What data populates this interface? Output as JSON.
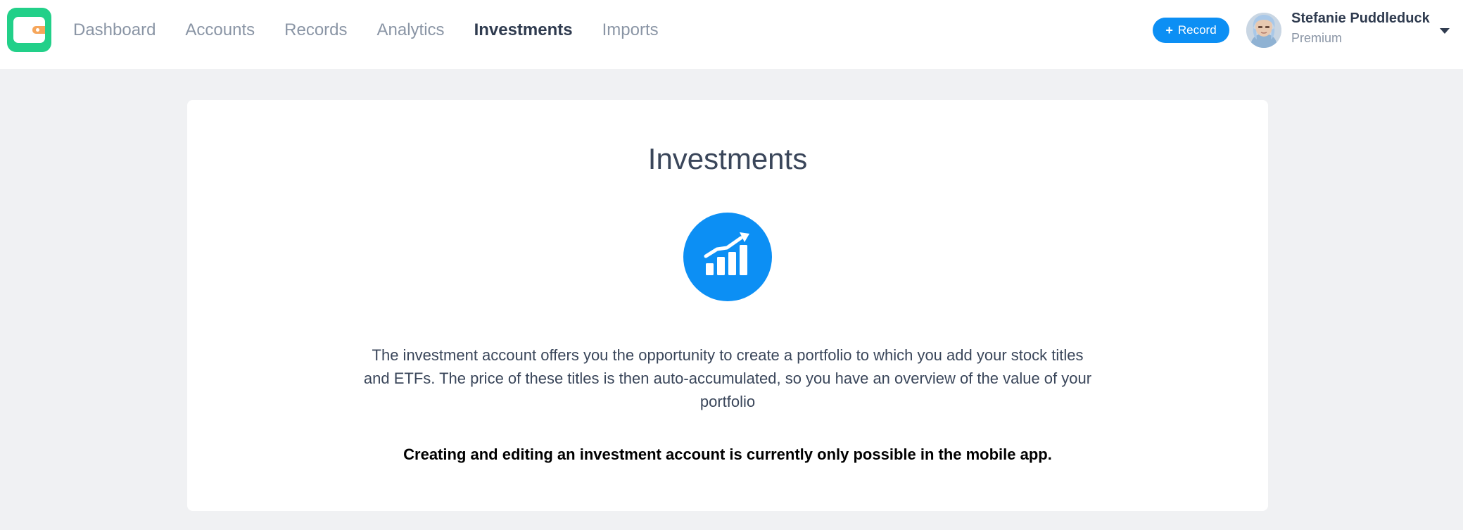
{
  "brand": {
    "logo_icon": "wallet-icon",
    "logo_color": "#22d089"
  },
  "nav": {
    "items": [
      {
        "label": "Dashboard",
        "active": false
      },
      {
        "label": "Accounts",
        "active": false
      },
      {
        "label": "Records",
        "active": false
      },
      {
        "label": "Analytics",
        "active": false
      },
      {
        "label": "Investments",
        "active": true
      },
      {
        "label": "Imports",
        "active": false
      }
    ]
  },
  "header": {
    "record_button": {
      "icon": "plus-icon",
      "label": "Record",
      "color": "#0c8ff4"
    },
    "user": {
      "name": "Stefanie Puddleduck",
      "plan": "Premium",
      "menu_icon": "chevron-down-icon"
    }
  },
  "main": {
    "title": "Investments",
    "icon": "growth-chart-icon",
    "description": "The investment account offers you the opportunity to create a portfolio to which you add your stock titles and ETFs. The price of these titles is then auto-accumulated, so you have an overview of the value of your portfolio",
    "notice": "Creating and editing an investment account is currently only possible in the mobile app."
  },
  "colors": {
    "accent": "#0c8ff4",
    "background": "#f0f1f3",
    "text_dark": "#2f3b4f",
    "text_muted": "#8a95a5"
  }
}
